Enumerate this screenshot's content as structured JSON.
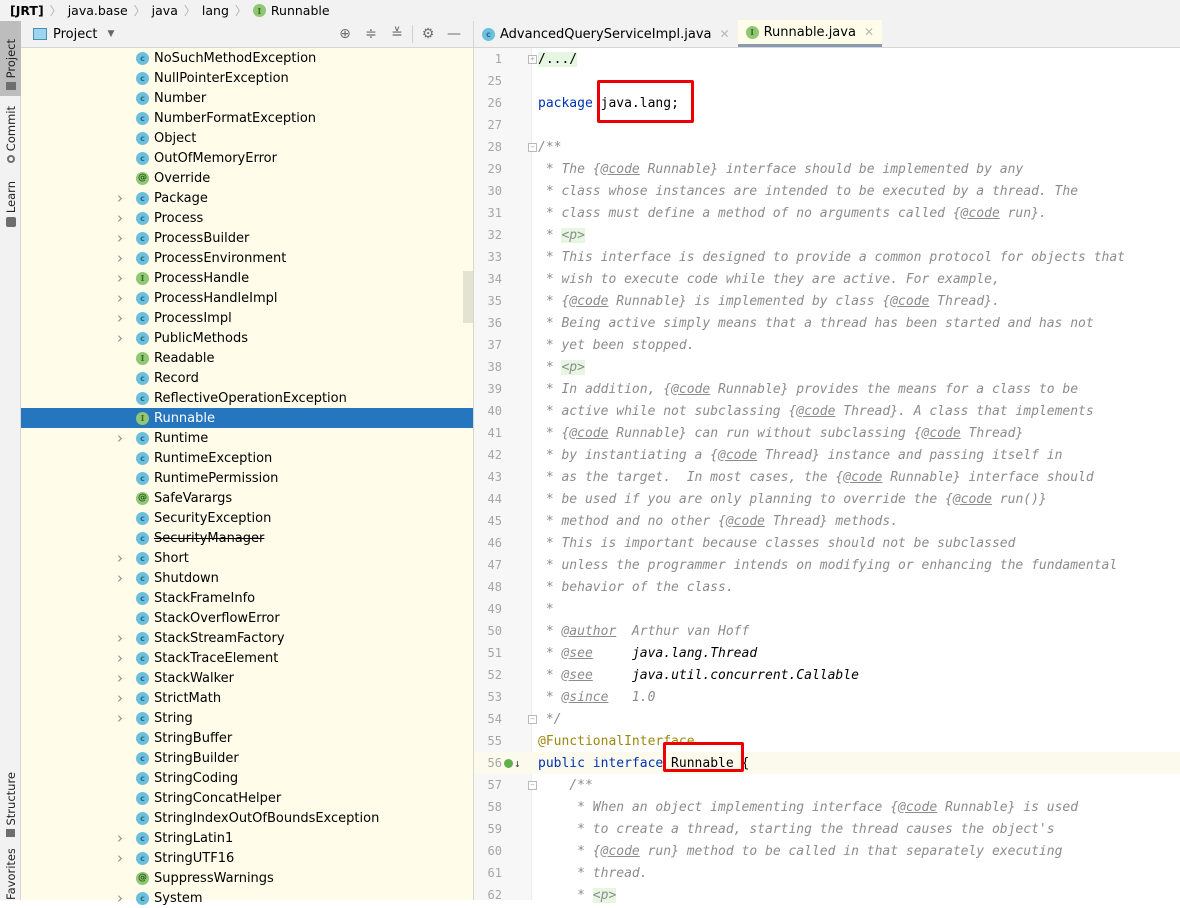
{
  "breadcrumb": {
    "items": [
      "[JRT]",
      "java.base",
      "java",
      "lang",
      "Runnable"
    ],
    "last_icon": "interface-icon"
  },
  "left_toolbar": {
    "top": [
      {
        "label": "Project",
        "icon": "folder-icon",
        "active": true
      },
      {
        "label": "Commit",
        "icon": "commit-icon",
        "active": false
      },
      {
        "label": "Learn",
        "icon": "learn-icon",
        "active": false
      }
    ],
    "bottom": [
      {
        "label": "Structure",
        "icon": "structure-icon"
      },
      {
        "label": "Favorites",
        "icon": "star-icon"
      }
    ]
  },
  "project_panel": {
    "title": "Project",
    "tools": [
      "locate-icon",
      "expand-all-icon",
      "collapse-all-icon",
      "gear-icon",
      "hide-icon"
    ],
    "items": [
      {
        "name": "NoSuchMethodException",
        "kind": "class",
        "expandable": false
      },
      {
        "name": "NullPointerException",
        "kind": "class",
        "expandable": false
      },
      {
        "name": "Number",
        "kind": "abstract-class",
        "expandable": false
      },
      {
        "name": "NumberFormatException",
        "kind": "class",
        "expandable": false
      },
      {
        "name": "Object",
        "kind": "class",
        "expandable": false
      },
      {
        "name": "OutOfMemoryError",
        "kind": "class",
        "expandable": false
      },
      {
        "name": "Override",
        "kind": "annotation",
        "expandable": false
      },
      {
        "name": "Package",
        "kind": "class",
        "expandable": true
      },
      {
        "name": "Process",
        "kind": "abstract-class",
        "expandable": true
      },
      {
        "name": "ProcessBuilder",
        "kind": "class",
        "expandable": true
      },
      {
        "name": "ProcessEnvironment",
        "kind": "class",
        "expandable": true
      },
      {
        "name": "ProcessHandle",
        "kind": "interface",
        "expandable": true
      },
      {
        "name": "ProcessHandleImpl",
        "kind": "class",
        "expandable": true
      },
      {
        "name": "ProcessImpl",
        "kind": "class",
        "expandable": true
      },
      {
        "name": "PublicMethods",
        "kind": "class",
        "expandable": true
      },
      {
        "name": "Readable",
        "kind": "interface",
        "expandable": false
      },
      {
        "name": "Record",
        "kind": "abstract-class",
        "expandable": false
      },
      {
        "name": "ReflectiveOperationException",
        "kind": "class",
        "expandable": false
      },
      {
        "name": "Runnable",
        "kind": "interface",
        "expandable": false,
        "selected": true
      },
      {
        "name": "Runtime",
        "kind": "class",
        "expandable": true
      },
      {
        "name": "RuntimeException",
        "kind": "class",
        "expandable": false
      },
      {
        "name": "RuntimePermission",
        "kind": "class",
        "expandable": false
      },
      {
        "name": "SafeVarargs",
        "kind": "annotation",
        "expandable": false
      },
      {
        "name": "SecurityException",
        "kind": "class",
        "expandable": false
      },
      {
        "name": "SecurityManager",
        "kind": "class",
        "expandable": false,
        "deprecated": true
      },
      {
        "name": "Short",
        "kind": "class",
        "expandable": true
      },
      {
        "name": "Shutdown",
        "kind": "class",
        "expandable": true
      },
      {
        "name": "StackFrameInfo",
        "kind": "class",
        "expandable": false
      },
      {
        "name": "StackOverflowError",
        "kind": "class",
        "expandable": false
      },
      {
        "name": "StackStreamFactory",
        "kind": "class",
        "expandable": true
      },
      {
        "name": "StackTraceElement",
        "kind": "class",
        "expandable": true
      },
      {
        "name": "StackWalker",
        "kind": "class",
        "expandable": true
      },
      {
        "name": "StrictMath",
        "kind": "class",
        "expandable": true
      },
      {
        "name": "String",
        "kind": "class",
        "expandable": true
      },
      {
        "name": "StringBuffer",
        "kind": "class",
        "expandable": false
      },
      {
        "name": "StringBuilder",
        "kind": "class",
        "expandable": false
      },
      {
        "name": "StringCoding",
        "kind": "class",
        "expandable": false
      },
      {
        "name": "StringConcatHelper",
        "kind": "class",
        "expandable": false
      },
      {
        "name": "StringIndexOutOfBoundsException",
        "kind": "class",
        "expandable": false
      },
      {
        "name": "StringLatin1",
        "kind": "class",
        "expandable": true
      },
      {
        "name": "StringUTF16",
        "kind": "class",
        "expandable": true
      },
      {
        "name": "SuppressWarnings",
        "kind": "annotation",
        "expandable": false
      },
      {
        "name": "System",
        "kind": "class",
        "expandable": true
      }
    ]
  },
  "editor": {
    "tabs": [
      {
        "label": "AdvancedQueryServiceImpl.java",
        "kind": "class",
        "active": false
      },
      {
        "label": "Runnable.java",
        "kind": "interface",
        "active": true
      }
    ],
    "lines": [
      {
        "n": "1",
        "html": "<span class='fold'>/.../</span>",
        "fold": "+"
      },
      {
        "n": "25",
        "html": ""
      },
      {
        "n": "26",
        "html": "<span class='kw'>package</span> java.lang;",
        "box": "package"
      },
      {
        "n": "27",
        "html": ""
      },
      {
        "n": "28",
        "html": "<span class='cm'>/**</span>",
        "fold": "-"
      },
      {
        "n": "29",
        "html": "<span class='cm'> * The {<span class='tag'>@code</span> Runnable} interface should be implemented by any</span>"
      },
      {
        "n": "30",
        "html": "<span class='cm'> * class whose instances are intended to be executed by a thread. The</span>"
      },
      {
        "n": "31",
        "html": "<span class='cm'> * class must define a method of no arguments called {<span class='tag'>@code</span> run}.</span>"
      },
      {
        "n": "32",
        "html": "<span class='cm'> * <span class='ptag'>&lt;p&gt;</span></span>"
      },
      {
        "n": "33",
        "html": "<span class='cm'> * This interface is designed to provide a common protocol for objects that</span>"
      },
      {
        "n": "34",
        "html": "<span class='cm'> * wish to execute code while they are active. For example,</span>"
      },
      {
        "n": "35",
        "html": "<span class='cm'> * {<span class='tag'>@code</span> Runnable} is implemented by class {<span class='tag'>@code</span> Thread}.</span>"
      },
      {
        "n": "36",
        "html": "<span class='cm'> * Being active simply means that a thread has been started and has not</span>"
      },
      {
        "n": "37",
        "html": "<span class='cm'> * yet been stopped.</span>"
      },
      {
        "n": "38",
        "html": "<span class='cm'> * <span class='ptag'>&lt;p&gt;</span></span>"
      },
      {
        "n": "39",
        "html": "<span class='cm'> * In addition, {<span class='tag'>@code</span> Runnable} provides the means for a class to be</span>"
      },
      {
        "n": "40",
        "html": "<span class='cm'> * active while not subclassing {<span class='tag'>@code</span> Thread}. A class that implements</span>"
      },
      {
        "n": "41",
        "html": "<span class='cm'> * {<span class='tag'>@code</span> Runnable} can run without subclassing {<span class='tag'>@code</span> Thread}</span>"
      },
      {
        "n": "42",
        "html": "<span class='cm'> * by instantiating a {<span class='tag'>@code</span> Thread} instance and passing itself in</span>"
      },
      {
        "n": "43",
        "html": "<span class='cm'> * as the target.  In most cases, the {<span class='tag'>@code</span> Runnable} interface should</span>"
      },
      {
        "n": "44",
        "html": "<span class='cm'> * be used if you are only planning to override the {<span class='tag'>@code</span> run()}</span>"
      },
      {
        "n": "45",
        "html": "<span class='cm'> * method and no other {<span class='tag'>@code</span> Thread} methods.</span>"
      },
      {
        "n": "46",
        "html": "<span class='cm'> * This is important because classes should not be subclassed</span>"
      },
      {
        "n": "47",
        "html": "<span class='cm'> * unless the programmer intends on modifying or enhancing the fundamental</span>"
      },
      {
        "n": "48",
        "html": "<span class='cm'> * behavior of the class.</span>"
      },
      {
        "n": "49",
        "html": "<span class='cm'> *</span>"
      },
      {
        "n": "50",
        "html": "<span class='cm'> * <span class='tag'>@author</span>  Arthur van Hoff</span>"
      },
      {
        "n": "51",
        "html": "<span class='cm'> * <span class='tag'>@see</span>     <span class='ref'>java.lang.Thread</span></span>"
      },
      {
        "n": "52",
        "html": "<span class='cm'> * <span class='tag'>@see</span>     <span class='ref'>java.util.concurrent.Callable</span></span>"
      },
      {
        "n": "53",
        "html": "<span class='cm'> * <span class='tag'>@since</span>   1.0</span>"
      },
      {
        "n": "54",
        "html": "<span class='cm'> */</span>",
        "fold": "-"
      },
      {
        "n": "55",
        "html": "<span class='ann'>@FunctionalInterface</span>"
      },
      {
        "n": "56",
        "html": "<span class='kw'>public interface</span> Runnable {",
        "caret": true,
        "gutter_icon": "implemented-icon",
        "box": "runnable"
      },
      {
        "n": "57",
        "html": "<span class='cm'>    /**</span>",
        "fold": "-"
      },
      {
        "n": "58",
        "html": "<span class='cm'>     * When an object implementing interface {<span class='tag'>@code</span> Runnable} is used</span>"
      },
      {
        "n": "59",
        "html": "<span class='cm'>     * to create a thread, starting the thread causes the object's</span>"
      },
      {
        "n": "60",
        "html": "<span class='cm'>     * {<span class='tag'>@code</span> run} method to be called in that separately executing</span>"
      },
      {
        "n": "61",
        "html": "<span class='cm'>     * thread.</span>"
      },
      {
        "n": "62",
        "html": "<span class='cm'>     * <span class='ptag'>&lt;p&gt;</span></span>"
      }
    ]
  },
  "colors": {
    "selection": "#2675bf",
    "tree_background": "#fffde9",
    "keyword": "#0033b3",
    "comment": "#8c8c8c",
    "annotation": "#9e880d",
    "highlight_box": "#ee0000"
  }
}
